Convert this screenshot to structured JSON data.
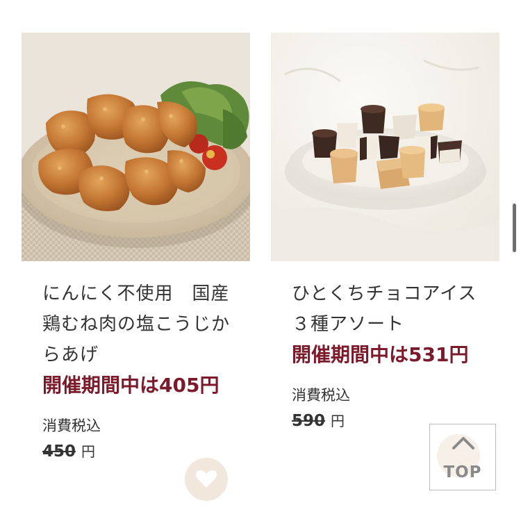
{
  "products": [
    {
      "image_alt": "karaage",
      "name": "にんにく不使用　国産鶏むね肉の塩こうじからあげ",
      "campaign_price": "開催期間中は405円",
      "tax_label": "消費税込",
      "regular_price": "450",
      "currency": "円"
    },
    {
      "image_alt": "choco-ice",
      "name": "ひとくちチョコアイス　３種アソート",
      "campaign_price": "開催期間中は531円",
      "tax_label": "消費税込",
      "regular_price": "590",
      "currency": "円"
    }
  ],
  "top_button": {
    "label": "TOP"
  },
  "colors": {
    "price_accent": "#7b1a2a",
    "favorite_bg": "#f1e7dc"
  }
}
